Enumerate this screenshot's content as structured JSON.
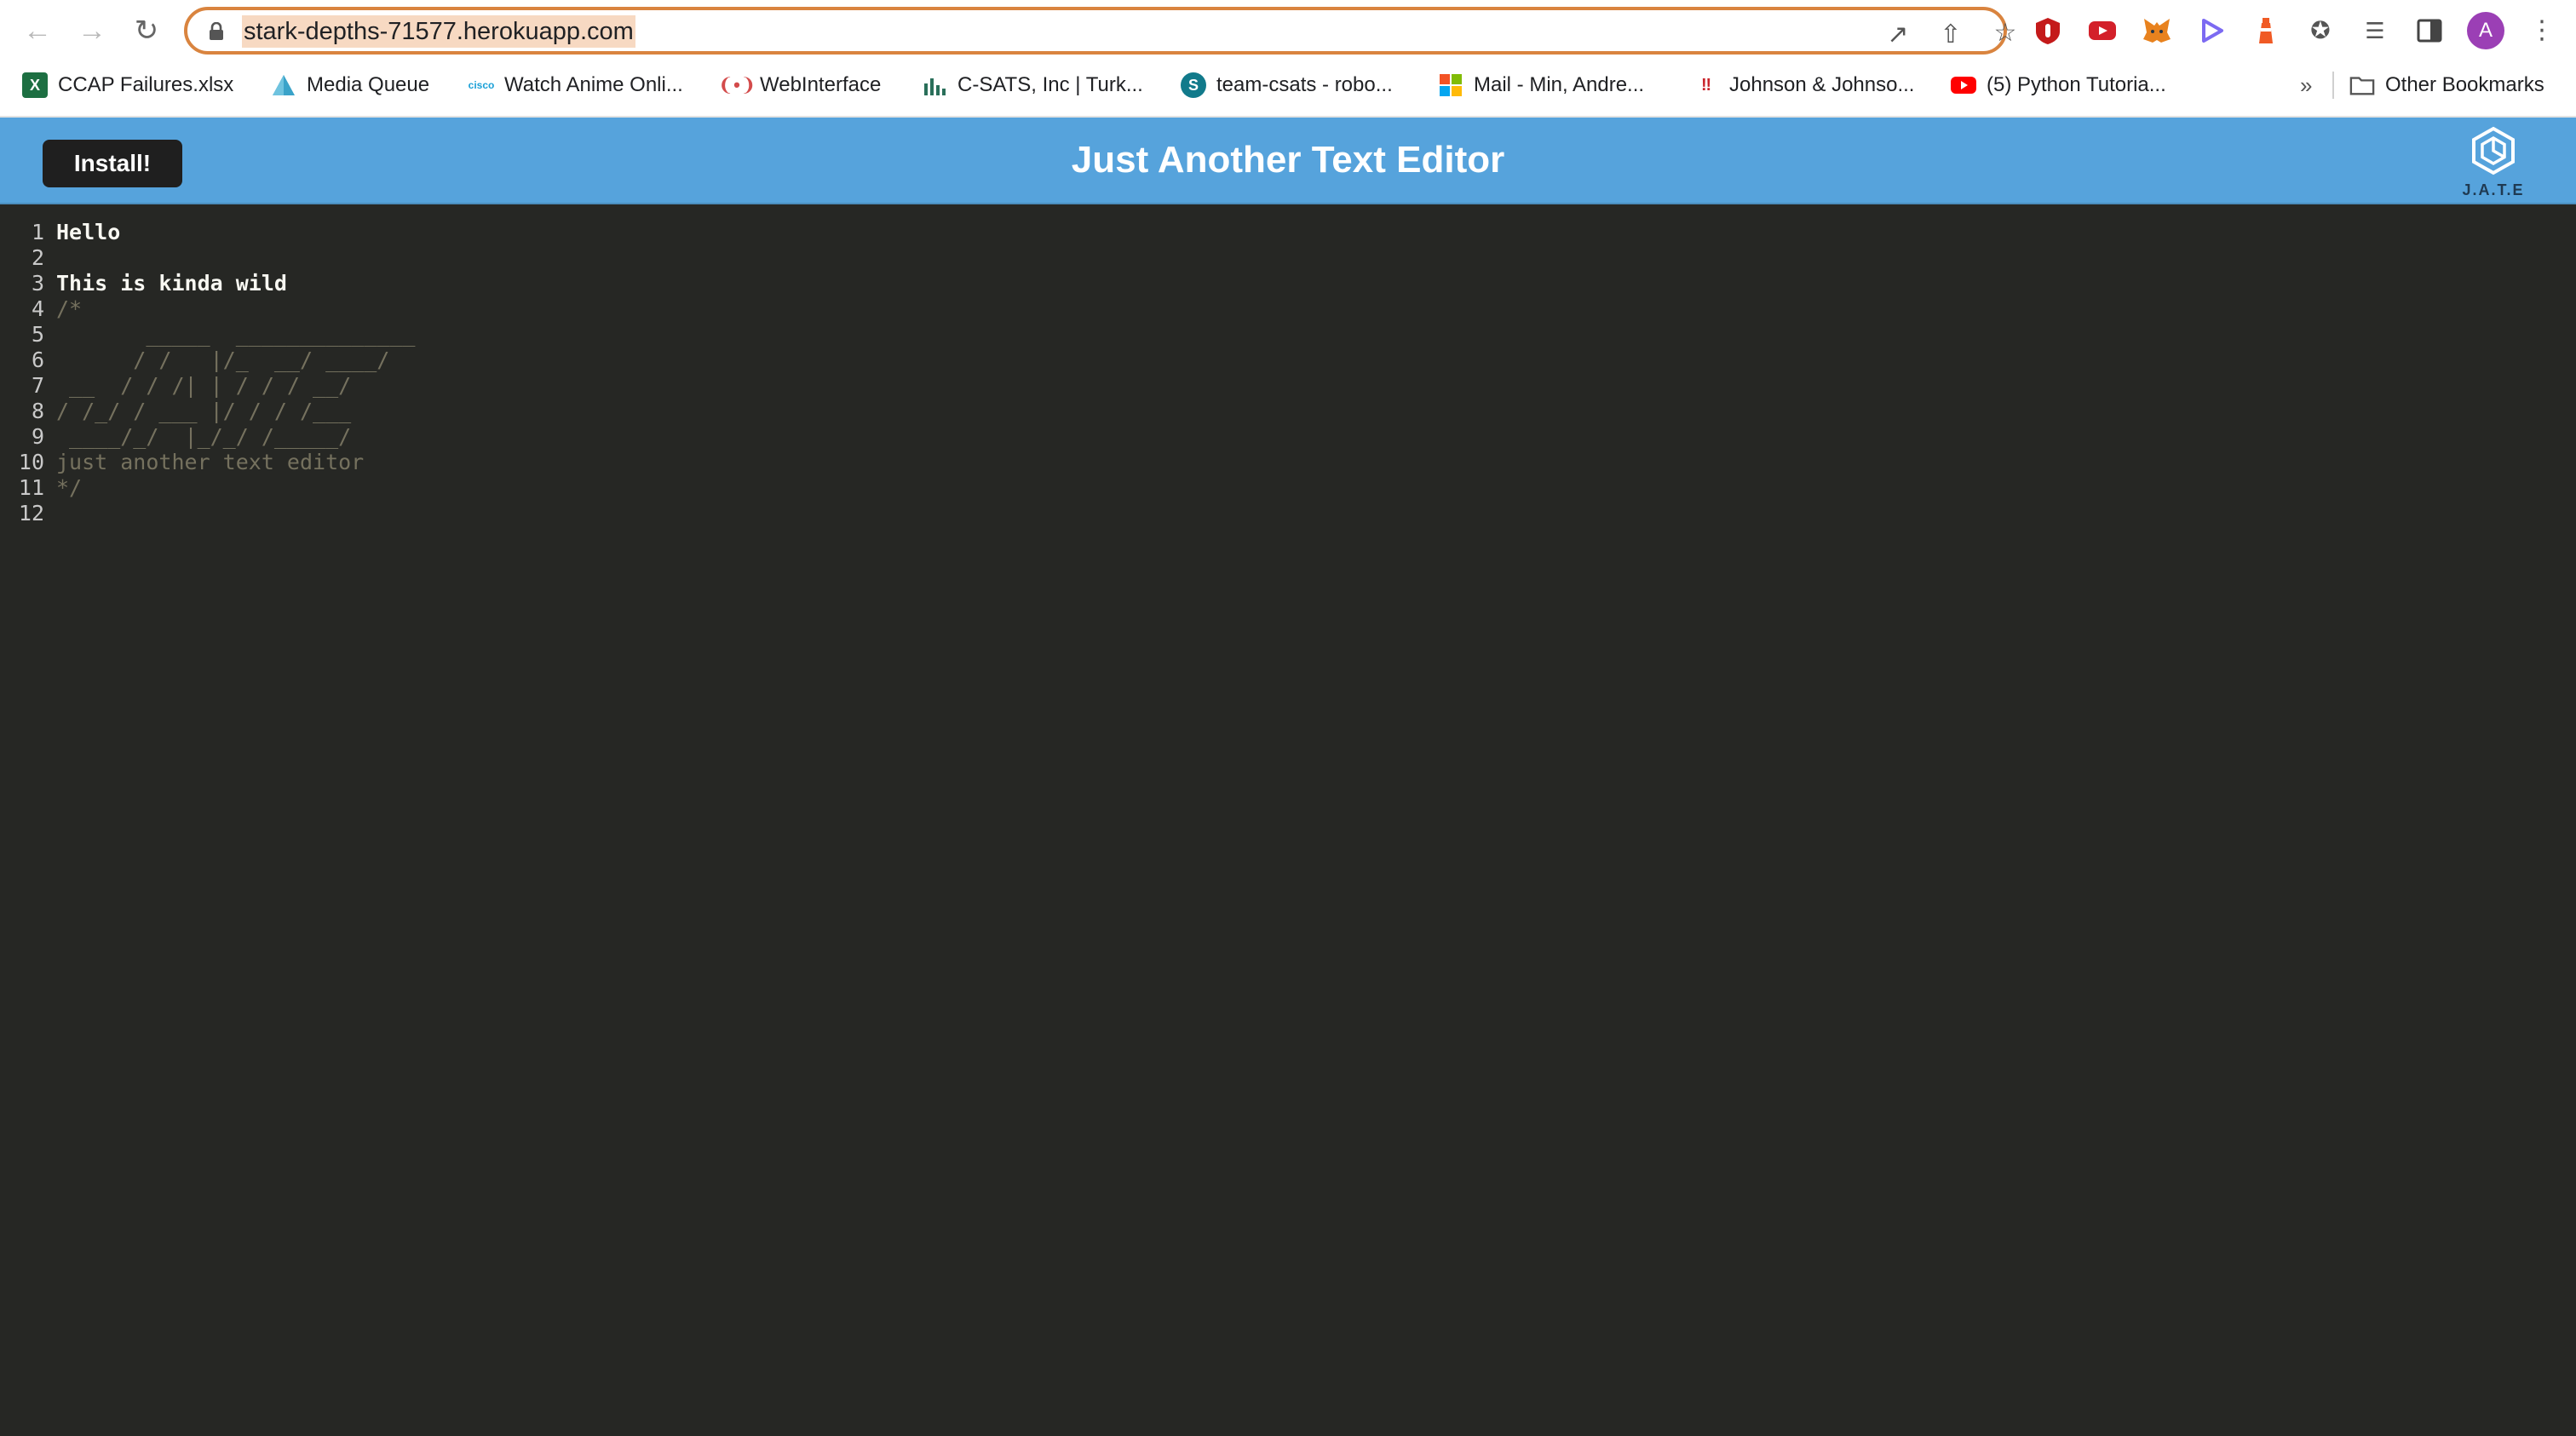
{
  "browser": {
    "url": "stark-depths-71577.herokuapp.com",
    "profile_initial": "A",
    "bookmarks": [
      {
        "label": "CCAP Failures.xlsx",
        "icon": "excel-icon",
        "color": "#1d6f42"
      },
      {
        "label": "Media Queue",
        "icon": "triangle-logo-icon",
        "color": "#3aa3c9"
      },
      {
        "label": "Watch Anime Onli...",
        "icon": "cisco-icon",
        "color": "#1ba0d7"
      },
      {
        "label": "WebInterface",
        "icon": "signal-icon",
        "color": "#d34b4b"
      },
      {
        "label": "C-SATS, Inc | Turk...",
        "icon": "bar-chart-icon",
        "color": "#2a6f5a"
      },
      {
        "label": "team-csats - robo...",
        "icon": "sharepoint-icon",
        "color": "#117a8b"
      },
      {
        "label": "Mail - Min, Andre...",
        "icon": "microsoft-icon",
        "color": "#f35325"
      },
      {
        "label": "Johnson & Johnso...",
        "icon": "jj-icon",
        "color": "#c9252c"
      },
      {
        "label": "(5) Python Tutoria...",
        "icon": "youtube-icon",
        "color": "#ff0000"
      }
    ],
    "overflow_label": "»",
    "other_bookmarks": "Other Bookmarks"
  },
  "app": {
    "install_label": "Install!",
    "title": "Just Another Text Editor",
    "logo_text": "J.A.T.E"
  },
  "editor": {
    "lines": [
      {
        "n": "1",
        "text": "Hello",
        "comment": false
      },
      {
        "n": "2",
        "text": "",
        "comment": false
      },
      {
        "n": "3",
        "text": "This is kinda wild",
        "comment": false
      },
      {
        "n": "4",
        "text": "/*",
        "comment": true
      },
      {
        "n": "5",
        "text": "       _____  ______________",
        "comment": true
      },
      {
        "n": "6",
        "text": "      / /   |/_  __/ ____/",
        "comment": true
      },
      {
        "n": "7",
        "text": " __  / / /| | / / / __/",
        "comment": true
      },
      {
        "n": "8",
        "text": "/ /_/ / ___ |/ / / /___",
        "comment": true
      },
      {
        "n": "9",
        "text": " ____/_/  |_/_/ /_____/",
        "comment": true
      },
      {
        "n": "10",
        "text": "just another text editor",
        "comment": true
      },
      {
        "n": "11",
        "text": "*/",
        "comment": true
      },
      {
        "n": "12",
        "text": "",
        "comment": false
      }
    ]
  }
}
